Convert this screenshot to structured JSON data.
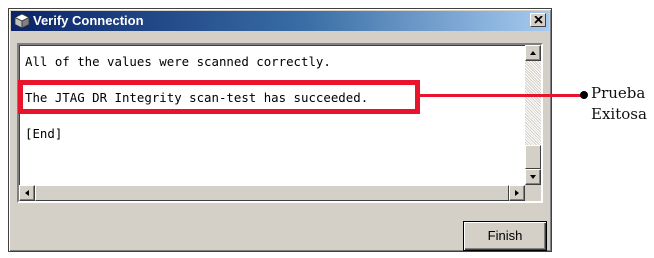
{
  "window": {
    "title": "Verify Connection",
    "title_icon": "cube-icon",
    "close_icon": "close-icon"
  },
  "output": {
    "lines": [
      "All of the values were scanned correctly.",
      "The JTAG DR Integrity scan-test has succeeded.",
      "[End]"
    ]
  },
  "buttons": {
    "finish_label": "Finish"
  },
  "annotation": {
    "label_line1": "Prueba",
    "label_line2": "Exitosa",
    "highlight_color": "#e8142c"
  },
  "colors": {
    "title_bar_start": "#0a246a",
    "title_bar_end": "#a6caf0",
    "dialog_face": "#d4d0c8"
  }
}
